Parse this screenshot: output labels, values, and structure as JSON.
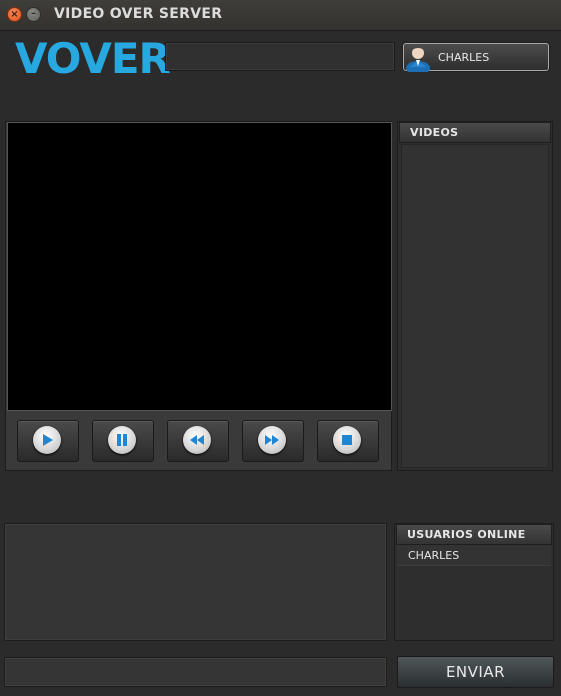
{
  "window": {
    "title": "VIDEO OVER SERVER",
    "close_glyph": "×",
    "minimize_glyph": "–"
  },
  "header": {
    "logo_text": "VOVER",
    "logo_color": "#27a8e0",
    "search_value": "",
    "user_button_label": "CHARLES"
  },
  "player": {
    "controls": [
      {
        "name": "play",
        "icon": "play-icon"
      },
      {
        "name": "pause",
        "icon": "pause-icon"
      },
      {
        "name": "rewind",
        "icon": "rewind-icon"
      },
      {
        "name": "fast-forward",
        "icon": "fast-forward-icon"
      },
      {
        "name": "stop",
        "icon": "stop-icon"
      }
    ],
    "icon_color": "#1f86d4"
  },
  "videos": {
    "title": "VIDEOS",
    "items": []
  },
  "chat": {
    "log": "",
    "input_value": "",
    "send_label": "ENVIAR"
  },
  "users_online": {
    "title": "USUARIOS ONLINE",
    "items": [
      "CHARLES"
    ]
  }
}
